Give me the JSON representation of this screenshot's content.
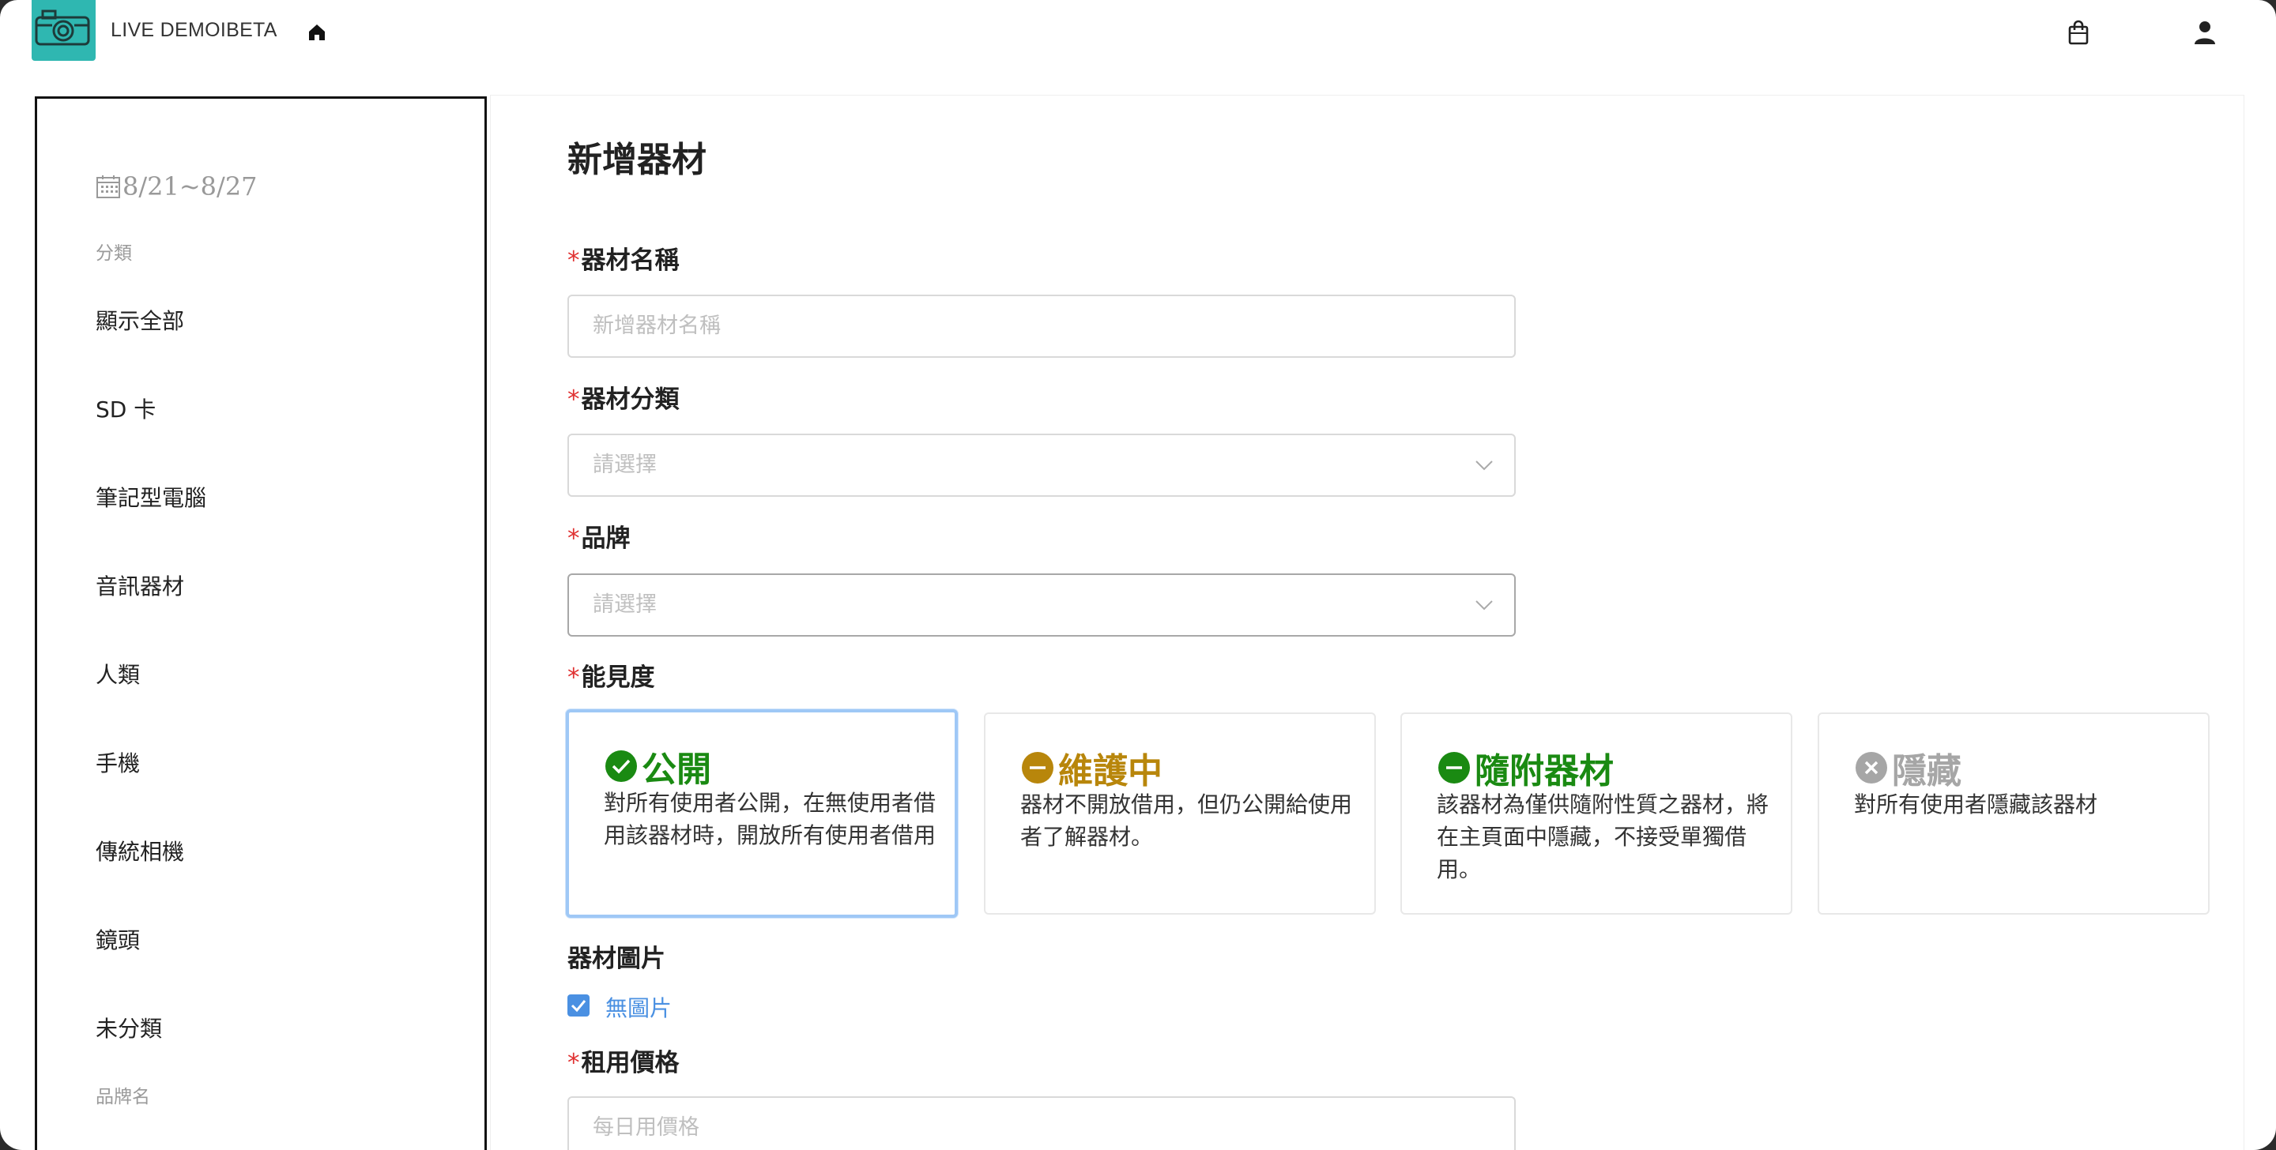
{
  "header": {
    "app_title": "LIVE DEMOIBETA",
    "icons": [
      "camera-logo-icon",
      "home-icon",
      "shopping-bag-icon",
      "user-icon"
    ]
  },
  "sidebar": {
    "date_range": "8/21~8/27",
    "category_heading": "分類",
    "items": [
      {
        "label": "顯示全部"
      },
      {
        "label": "SD 卡"
      },
      {
        "label": "筆記型電腦"
      },
      {
        "label": "音訊器材"
      },
      {
        "label": "人類"
      },
      {
        "label": "手機"
      },
      {
        "label": "傳統相機"
      },
      {
        "label": "鏡頭"
      },
      {
        "label": "未分類"
      }
    ],
    "brand_heading": "品牌名"
  },
  "form": {
    "title": "新增器材",
    "required_mark": "*",
    "name": {
      "label": "器材名稱",
      "placeholder": "新增器材名稱"
    },
    "category": {
      "label": "器材分類",
      "placeholder": "請選擇"
    },
    "brand": {
      "label": "品牌",
      "placeholder": "請選擇"
    },
    "visibility": {
      "label": "能見度",
      "selected": "公開",
      "options": [
        {
          "title": "公開",
          "description": "對所有使用者公開，在無使用者借用該器材時，開放所有使用者借用",
          "color": "#1a8a12",
          "icon": "check-circle-icon"
        },
        {
          "title": "維護中",
          "description": "器材不開放借用，但仍公開給使用者了解器材。",
          "color": "#b8860b",
          "icon": "minus-circle-icon"
        },
        {
          "title": "隨附器材",
          "description": "該器材為僅供隨附性質之器材，將在主頁面中隱藏，不接受單獨借用。",
          "color": "#1a8a12",
          "icon": "minus-circle-icon"
        },
        {
          "title": "隱藏",
          "description": "對所有使用者隱藏該器材",
          "color": "#a6a6a6",
          "icon": "x-circle-icon"
        }
      ]
    },
    "image": {
      "label": "器材圖片",
      "no_image_label": "無圖片",
      "no_image_checked": true
    },
    "price": {
      "label": "租用價格",
      "placeholder": "每日用價格"
    }
  },
  "colors": {
    "accent_blue": "#4a90e2",
    "required_red": "#e03131",
    "logo_teal": "#2fb7b1"
  }
}
